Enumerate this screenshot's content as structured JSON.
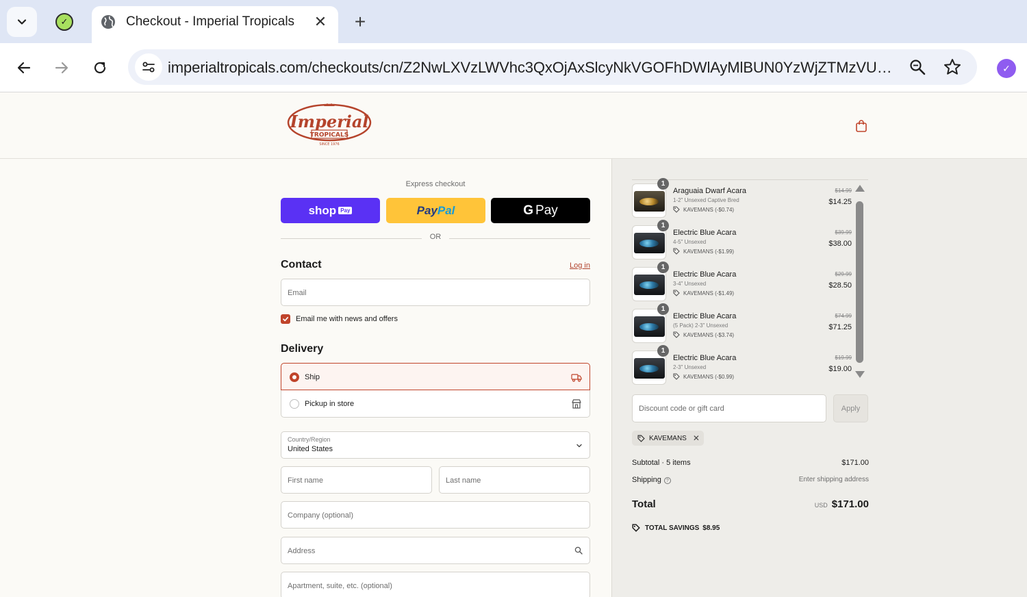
{
  "browser": {
    "tab_title": "Checkout - Imperial Tropicals",
    "url": "imperialtropicals.com/checkouts/cn/Z2NwLXVzLWVhc3QxOjAxSlcyNkVGOFhDWlAyMlBUN0YzWjZTMzVU?aut..."
  },
  "express": {
    "label": "Express checkout",
    "shop_pay": "shop",
    "shop_pay_badge": "Pay",
    "paypal_a": "Pay",
    "paypal_b": "Pal",
    "gpay_g": "G",
    "gpay_text": "Pay",
    "or": "OR"
  },
  "contact": {
    "title": "Contact",
    "login": "Log in",
    "email_placeholder": "Email",
    "newsletter_label": "Email me with news and offers",
    "newsletter_checked": true
  },
  "delivery": {
    "title": "Delivery",
    "options": [
      {
        "label": "Ship",
        "selected": true,
        "icon": "truck-icon"
      },
      {
        "label": "Pickup in store",
        "selected": false,
        "icon": "store-icon"
      }
    ],
    "country_label": "Country/Region",
    "country_value": "United States",
    "first_name": "First name",
    "last_name": "Last name",
    "company": "Company (optional)",
    "address": "Address",
    "apartment": "Apartment, suite, etc. (optional)"
  },
  "cart": {
    "items": [
      {
        "qty": "1",
        "name": "Araguaia Dwarf Acara",
        "variant": "1-2\" Unsexed Captive Bred",
        "discount": "KAVEMANS (-$0.74)",
        "was": "$14.99",
        "price": "$14.25"
      },
      {
        "qty": "1",
        "name": "Electric Blue Acara",
        "variant": "4-5\" Unsexed",
        "discount": "KAVEMANS (-$1.99)",
        "was": "$39.99",
        "price": "$38.00"
      },
      {
        "qty": "1",
        "name": "Electric Blue Acara",
        "variant": "3-4\" Unsexed",
        "discount": "KAVEMANS (-$1.49)",
        "was": "$29.99",
        "price": "$28.50"
      },
      {
        "qty": "1",
        "name": "Electric Blue Acara",
        "variant": "(5 Pack) 2-3\" Unsexed",
        "discount": "KAVEMANS (-$3.74)",
        "was": "$74.99",
        "price": "$71.25"
      },
      {
        "qty": "1",
        "name": "Electric Blue Acara",
        "variant": "2-3\" Unsexed",
        "discount": "KAVEMANS (-$0.99)",
        "was": "$19.99",
        "price": "$19.00"
      }
    ],
    "discount_placeholder": "Discount code or gift card",
    "apply_label": "Apply",
    "applied_code": "KAVEMANS",
    "subtotal_label": "Subtotal · 5 items",
    "subtotal_value": "$171.00",
    "shipping_label": "Shipping",
    "shipping_value": "Enter shipping address",
    "total_label": "Total",
    "total_currency": "USD",
    "total_value": "$171.00",
    "savings_label": "TOTAL SAVINGS",
    "savings_value": "$8.95"
  },
  "colors": {
    "accent": "#c0442b",
    "shop_pay": "#5a31f4",
    "paypal": "#ffc439"
  }
}
